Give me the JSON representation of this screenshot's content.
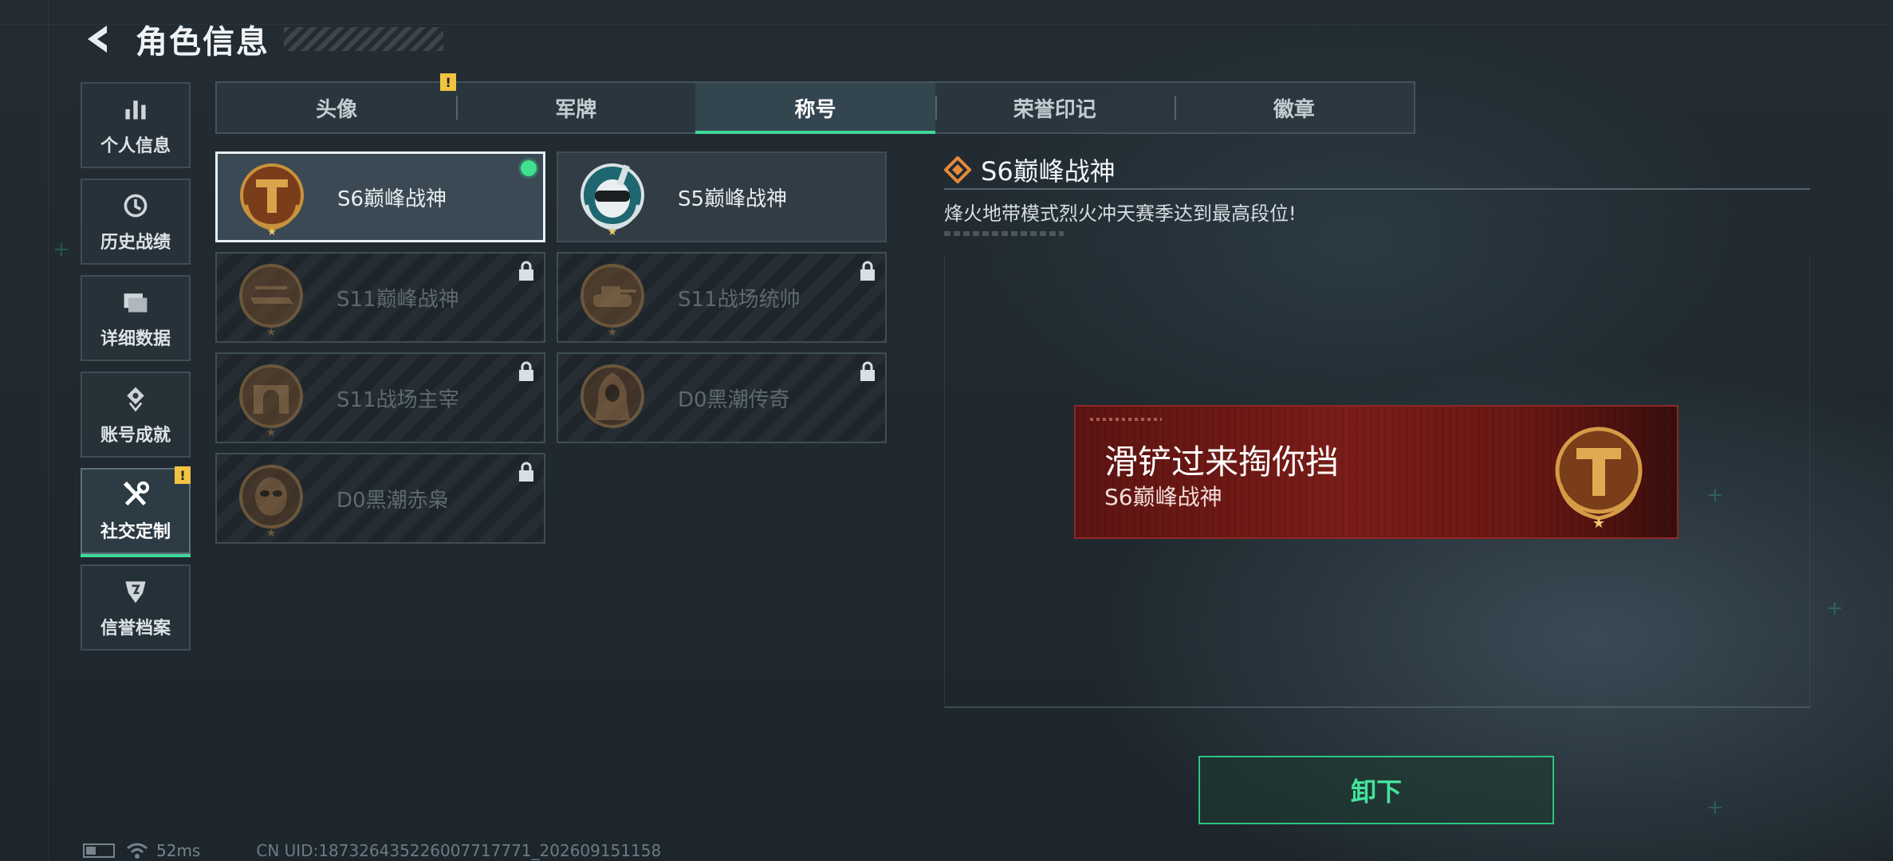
{
  "header": {
    "title": "角色信息"
  },
  "sidebar": {
    "items": [
      {
        "label": "个人信息",
        "icon": "bar-chart-icon",
        "active": false,
        "warning": false
      },
      {
        "label": "历史战绩",
        "icon": "history-icon",
        "active": false,
        "warning": false
      },
      {
        "label": "详细数据",
        "icon": "folder-icon",
        "active": false,
        "warning": false
      },
      {
        "label": "账号成就",
        "icon": "achievement-icon",
        "active": false,
        "warning": false
      },
      {
        "label": "社交定制",
        "icon": "wrench-screwdriver-icon",
        "active": true,
        "warning": true,
        "warning_mark": "!"
      },
      {
        "label": "信誉档案",
        "icon": "shield-icon",
        "active": false,
        "warning": false
      }
    ]
  },
  "tabs": [
    {
      "label": "头像",
      "active": false,
      "warning": true,
      "warning_mark": "!"
    },
    {
      "label": "军牌",
      "active": false
    },
    {
      "label": "称号",
      "active": true
    },
    {
      "label": "荣誉印记",
      "active": false
    },
    {
      "label": "徽章",
      "active": false
    }
  ],
  "titles": [
    {
      "name": "S6巅峰战神",
      "medal": "t-emblem-medal-icon",
      "locked": false,
      "selected": true,
      "equipped": true
    },
    {
      "name": "S5巅峰战神",
      "medal": "skull-goggles-medal-icon",
      "locked": false,
      "selected": false,
      "equipped": false
    },
    {
      "name": "S11巅峰战神",
      "medal": "helicopter-medal-icon",
      "locked": true
    },
    {
      "name": "S11战场统帅",
      "medal": "tank-medal-icon",
      "locked": true
    },
    {
      "name": "S11战场主宰",
      "medal": "arch-medal-icon",
      "locked": true
    },
    {
      "name": "D0黑潮传奇",
      "medal": "hooded-figure-medal-icon",
      "locked": true
    },
    {
      "name": "D0黑潮赤枭",
      "medal": "mask-medal-icon",
      "locked": true
    }
  ],
  "detail": {
    "title": "S6巅峰战神",
    "description": "烽火地带模式烈火冲天赛季达到最高段位!"
  },
  "banner": {
    "nickname": "滑铲过来掏你挡",
    "title": "S6巅峰战神"
  },
  "action": {
    "label": "卸下"
  },
  "status": {
    "ping": "52ms",
    "uid": "CN UID:18732643522600771777​1_202609151158"
  },
  "colors": {
    "accent": "#3fd79a",
    "warning": "#f0c442",
    "banner_red": "#7b1d18",
    "medal_gold": "#c8913c"
  }
}
